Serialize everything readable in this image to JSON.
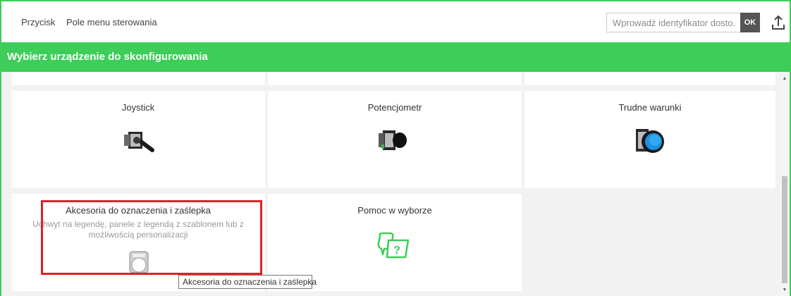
{
  "header": {
    "nav": [
      {
        "label": "Przycisk"
      },
      {
        "label": "Pole menu sterowania"
      }
    ],
    "search": {
      "placeholder": "Wprowadź identyfikator dosto...",
      "ok_label": "OK"
    },
    "upload_icon": "upload-icon"
  },
  "banner": {
    "title": "Wybierz urządzenie do skonfigurowania",
    "color": "#3dcd58"
  },
  "cards": [
    {
      "title": "Joystick",
      "icon": "joystick-device-image"
    },
    {
      "title": "Potencjometr",
      "icon": "potentiometer-device-image"
    },
    {
      "title": "Trudne warunki",
      "icon": "harsh-conditions-device-image"
    },
    {
      "title": "Akcesoria do oznaczenia i zaślepka",
      "description": "Uchwyt na legendę, panele z legendą z szablonem lub z możliwością personalizacji",
      "icon": "legend-holder-image"
    },
    {
      "title": "Pomoc w wyborze",
      "icon": "help-selection-icon"
    }
  ],
  "tooltip": {
    "text": "Akcesoria do oznaczenia i zaślepka"
  },
  "highlight_color": "#e0202a"
}
